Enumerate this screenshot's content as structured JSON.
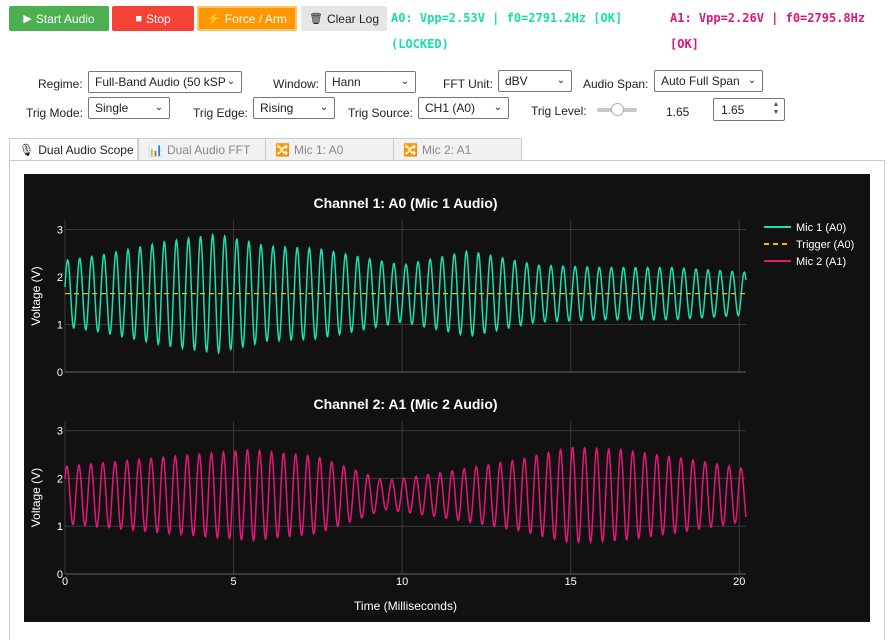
{
  "toolbar": {
    "start": {
      "icon": "play-icon",
      "label": "Start Audio",
      "color": "#4caf50"
    },
    "stop": {
      "icon": "stop-icon",
      "label": "Stop",
      "color": "#f44336"
    },
    "force": {
      "icon": "lightning-icon",
      "label": "Force / Arm",
      "color": "#ff9800"
    },
    "clear": {
      "icon": "trash-icon",
      "label": "Clear Log"
    }
  },
  "status": {
    "a0_line1": "A0: Vpp=2.53V | f0=2791.2Hz [OK]",
    "a0_line2": "(LOCKED)",
    "a1_line1": "A1: Vpp=2.26V | f0=2795.8Hz",
    "a1_line2": "[OK]",
    "a0_color": "#19e0a8",
    "a1_color": "#e0147c"
  },
  "controls": {
    "regime": {
      "label": "Regime:",
      "value": "Full-Band Audio (50 kSP"
    },
    "window": {
      "label": "Window:",
      "value": "Hann"
    },
    "fft_unit": {
      "label": "FFT Unit:",
      "value": "dBV"
    },
    "audio_span": {
      "label": "Audio Span:",
      "value": "Auto Full Span"
    },
    "trig_mode": {
      "label": "Trig Mode:",
      "value": "Single"
    },
    "trig_edge": {
      "label": "Trig Edge:",
      "value": "Rising"
    },
    "trig_source": {
      "label": "Trig Source:",
      "value": "CH1 (A0)"
    },
    "trig_level": {
      "label": "Trig Level:",
      "value": "1.65",
      "input_value": "1.65",
      "slider_fraction": 0.5
    }
  },
  "tabs": [
    {
      "icon": "microphone-icon",
      "label": "Dual Audio Scope",
      "active": true
    },
    {
      "icon": "bar-chart-icon",
      "label": "Dual Audio FFT",
      "active": false
    },
    {
      "icon": "shuffle-icon",
      "label": "Mic 1: A0",
      "active": false
    },
    {
      "icon": "shuffle-icon",
      "label": "Mic 2: A1",
      "active": false
    }
  ],
  "chart_data": [
    {
      "type": "line",
      "title": "Channel 1: A0 (Mic 1 Audio)",
      "ylabel": "Voltage (V)",
      "xlim": [
        0,
        20.2
      ],
      "ylim": [
        0,
        3.2
      ],
      "yticks": [
        "0",
        "1",
        "2",
        "3"
      ],
      "grid": true,
      "legend": "top-right",
      "series": [
        {
          "name": "Mic 1 (A0)",
          "color": "#19e0b0",
          "style": "solid",
          "frequency_khz": 2.79,
          "center_v": 1.65,
          "amplitude_envelope_v": [
            [
              0,
              0.7
            ],
            [
              1,
              0.8
            ],
            [
              3,
              1.1
            ],
            [
              4.5,
              1.25
            ],
            [
              6,
              1.0
            ],
            [
              7.5,
              0.95
            ],
            [
              10,
              0.6
            ],
            [
              12,
              0.9
            ],
            [
              14,
              0.6
            ],
            [
              16,
              0.55
            ],
            [
              18,
              0.55
            ],
            [
              20.2,
              0.45
            ]
          ]
        },
        {
          "name": "Trigger (A0)",
          "color": "#ffb000",
          "style": "dashed",
          "value_v": 1.65
        }
      ]
    },
    {
      "type": "line",
      "title": "Channel 2: A1 (Mic 2 Audio)",
      "xlabel": "Time (Milliseconds)",
      "ylabel": "Voltage (V)",
      "xlim": [
        0,
        20.2
      ],
      "ylim": [
        0,
        3.2
      ],
      "yticks": [
        "0",
        "1",
        "2",
        "3"
      ],
      "xticks": [
        "0",
        "5",
        "10",
        "15",
        "20"
      ],
      "grid": true,
      "series": [
        {
          "name": "Mic 2 (A1)",
          "color": "#e6157c",
          "style": "solid",
          "frequency_khz": 2.8,
          "center_v": 1.65,
          "amplitude_envelope_v": [
            [
              0,
              0.6
            ],
            [
              3,
              0.8
            ],
            [
              5.5,
              0.95
            ],
            [
              7.5,
              0.8
            ],
            [
              9.5,
              0.3
            ],
            [
              11,
              0.45
            ],
            [
              13.5,
              0.75
            ],
            [
              15,
              1.0
            ],
            [
              16.5,
              0.95
            ],
            [
              18.5,
              0.75
            ],
            [
              20.2,
              0.55
            ]
          ]
        }
      ]
    }
  ]
}
